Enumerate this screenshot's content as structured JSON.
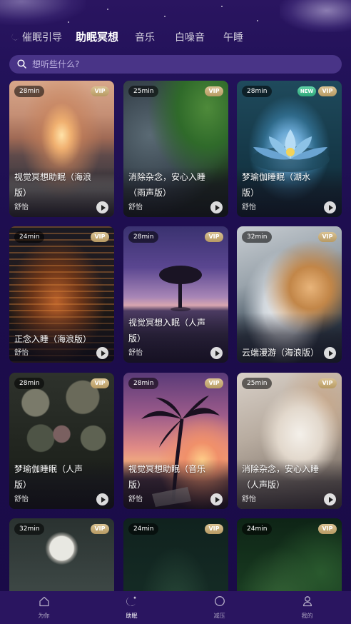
{
  "tabs": [
    {
      "label": "催眠引导",
      "icon": "moon-icon",
      "active": false
    },
    {
      "label": "助眠冥想",
      "active": true
    },
    {
      "label": "音乐",
      "active": false
    },
    {
      "label": "白噪音",
      "active": false
    },
    {
      "label": "午睡",
      "active": false
    }
  ],
  "search": {
    "placeholder": "想听些什么?"
  },
  "cards": [
    {
      "duration": "28min",
      "badge": "VIP",
      "title": "视觉冥想助眠（海浪版）",
      "author": "舒怡"
    },
    {
      "duration": "25min",
      "badge": "VIP",
      "title": "消除杂念，安心入睡（雨声版）",
      "author": "舒怡"
    },
    {
      "duration": "28min",
      "badge": "VIP",
      "new_badge": "NEW",
      "title": "梦瑜伽睡眠（湖水版）",
      "author": "舒怡"
    },
    {
      "duration": "24min",
      "badge": "VIP",
      "title": "正念入睡（海浪版）",
      "author": "舒怡"
    },
    {
      "duration": "28min",
      "badge": "VIP",
      "title": "视觉冥想入眠（人声版）",
      "author": "舒怡"
    },
    {
      "duration": "32min",
      "badge": "VIP",
      "title": "云端漫游（海浪版）",
      "author": ""
    },
    {
      "duration": "28min",
      "badge": "VIP",
      "title": "梦瑜伽睡眠（人声版）",
      "author": "舒怡"
    },
    {
      "duration": "28min",
      "badge": "VIP",
      "title": "视觉冥想助眠（音乐版）",
      "author": "舒怡"
    },
    {
      "duration": "25min",
      "badge": "VIP",
      "title": "消除杂念，安心入睡（人声版）",
      "author": "舒怡"
    },
    {
      "duration": "32min",
      "badge": "VIP",
      "title": "",
      "author": ""
    },
    {
      "duration": "24min",
      "badge": "VIP",
      "title": "",
      "author": ""
    },
    {
      "duration": "24min",
      "badge": "VIP",
      "title": "",
      "author": ""
    }
  ],
  "nav": [
    {
      "label": "为你",
      "icon": "home-icon"
    },
    {
      "label": "助眠",
      "icon": "moon-star-icon",
      "active": true
    },
    {
      "label": "减压",
      "icon": "circle-icon"
    },
    {
      "label": "我的",
      "icon": "user-icon"
    }
  ],
  "colors": {
    "background": "#1e0f4e",
    "nav_bg": "#2a1560",
    "vip_gold": "#c9ad78",
    "new_green": "#3fbc8a"
  }
}
